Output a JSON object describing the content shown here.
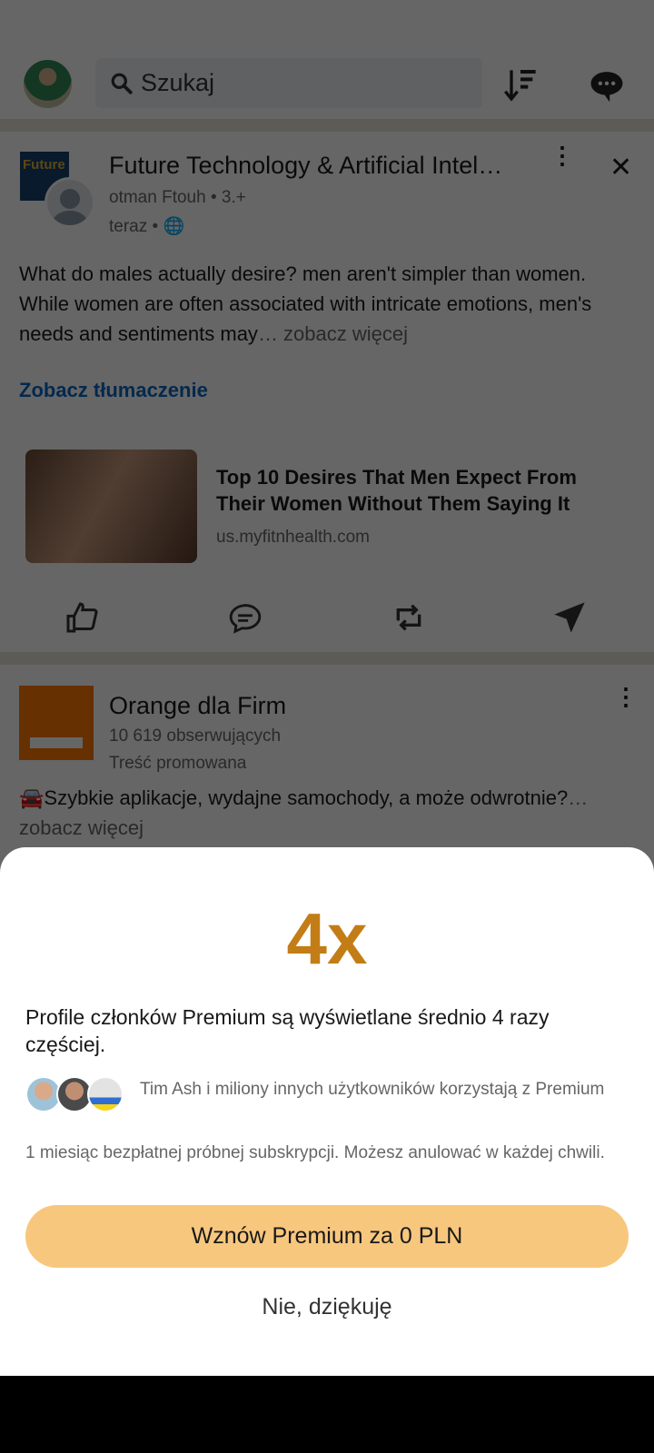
{
  "header": {
    "search_placeholder": "Szukaj"
  },
  "post1": {
    "author": "Future Technology & Artificial Intel…",
    "subtitle": "otman Ftouh • 3.+",
    "time": "teraz •",
    "text": "What do males actually desire? men aren't simpler than women. While women are often associated with intricate emotions, men's needs and sentiments may",
    "see_more": "… zobacz więcej",
    "translate": "Zobacz tłumaczenie",
    "logo_text": "Future",
    "link": {
      "title": "Top 10 Desires That Men Expect From Their Women Without Them Saying It",
      "domain": "us.myfitnhealth.com"
    }
  },
  "post2": {
    "author": "Orange dla Firm",
    "followers": "10 619 obserwujących",
    "promoted": "Treść promowana",
    "text": "🚘Szybkie aplikacje, wydajne samochody, a może odwrotnie?",
    "see_more": "… zobacz więcej"
  },
  "sheet": {
    "headline": "4x",
    "headline_color": "#c37d16",
    "description": "Profile członków Premium są wyświetlane średnio 4 razy częściej.",
    "social_proof": "Tim Ash i miliony innych użytkowników korzystają z Premium",
    "trial": "1 miesiąc bezpłatnej próbnej subskrypcji. Możesz anulować w każdej chwili.",
    "cta": "Wznów Premium za 0 PLN",
    "cta_color": "#f8c77e",
    "dismiss": "Nie, dziękuję"
  }
}
